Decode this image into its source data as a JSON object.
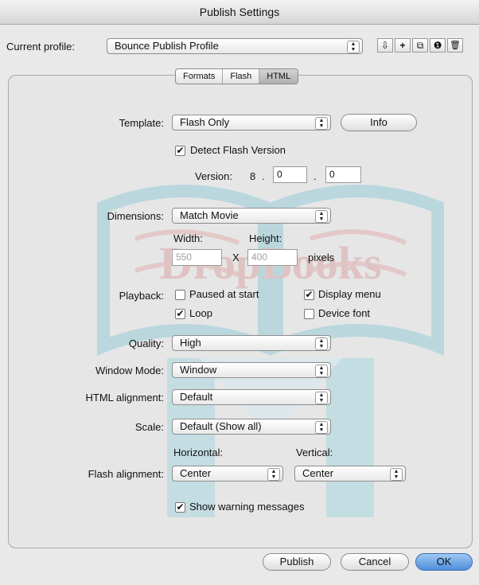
{
  "window": {
    "title": "Publish Settings"
  },
  "profile": {
    "label": "Current profile:",
    "value": "Bounce Publish Profile"
  },
  "toolbar": {
    "icons": [
      "import-export-icon",
      "add-profile-icon",
      "duplicate-profile-icon",
      "profile-properties-icon",
      "delete-profile-icon"
    ],
    "glyphs": [
      "⇩",
      "+",
      "⧉",
      "❶",
      "🗑"
    ]
  },
  "tabs": [
    "Formats",
    "Flash",
    "HTML"
  ],
  "form": {
    "template_label": "Template:",
    "template_value": "Flash Only",
    "info_button": "Info",
    "detect_label": "Detect Flash Version",
    "detect_checked": true,
    "version_label": "Version:",
    "version_major": "8",
    "version_sep": ".",
    "version_minor": "0",
    "version_revision": "0",
    "dimensions_label": "Dimensions:",
    "dimensions_value": "Match Movie",
    "width_label": "Width:",
    "height_label": "Height:",
    "width_value": "550",
    "height_value": "400",
    "times": "X",
    "pixels": "pixels",
    "playback_label": "Playback:",
    "paused_label": "Paused at start",
    "paused_checked": false,
    "display_menu_label": "Display menu",
    "display_menu_checked": true,
    "loop_label": "Loop",
    "loop_checked": true,
    "device_font_label": "Device font",
    "device_font_checked": false,
    "quality_label": "Quality:",
    "quality_value": "High",
    "window_mode_label": "Window Mode:",
    "window_mode_value": "Window",
    "html_align_label": "HTML alignment:",
    "html_align_value": "Default",
    "scale_label": "Scale:",
    "scale_value": "Default (Show all)",
    "horizontal_label": "Horizontal:",
    "vertical_label": "Vertical:",
    "flash_align_label": "Flash alignment:",
    "flash_align_h": "Center",
    "flash_align_v": "Center",
    "warnings_label": "Show warning messages",
    "warnings_checked": true
  },
  "buttons": {
    "publish": "Publish",
    "cancel": "Cancel",
    "ok": "OK"
  },
  "watermark": {
    "text": "DropBooks"
  },
  "colors": {
    "default_button": "#5b9be2",
    "watermark": "#86c7d6"
  }
}
